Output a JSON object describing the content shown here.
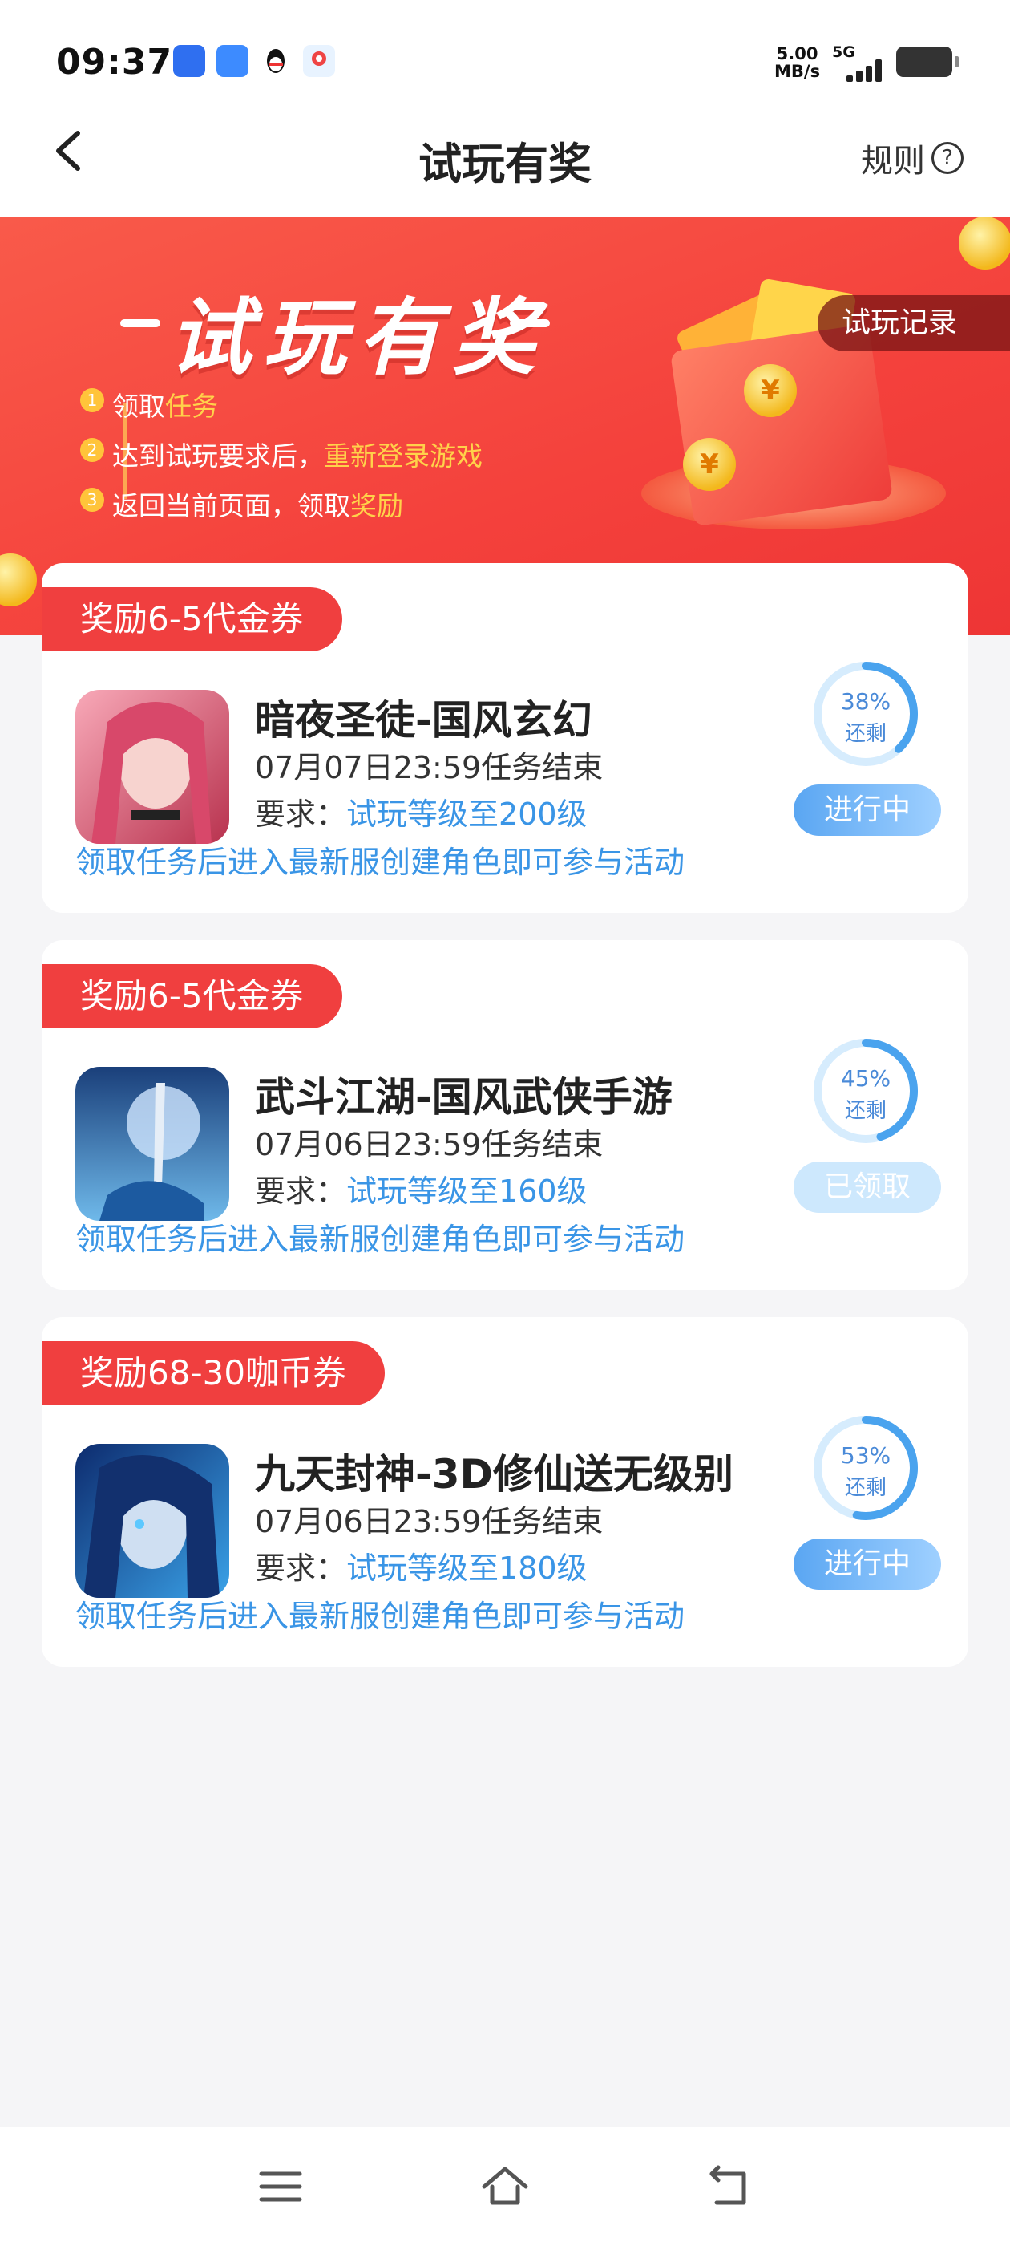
{
  "status_bar": {
    "time": "09:37",
    "net_speed_value": "5.00",
    "net_speed_unit": "MB/s",
    "network": "5G",
    "icons": [
      "baidu-map-icon",
      "browser-icon",
      "qq-icon",
      "maps-pin-icon"
    ]
  },
  "nav": {
    "title": "试玩有奖",
    "rules_label": "规则"
  },
  "banner": {
    "title": "试玩有奖",
    "record_button": "试玩记录",
    "steps": [
      {
        "num": "1",
        "text": "领取",
        "highlight": "任务"
      },
      {
        "num": "2",
        "text": "达到试玩要求后，",
        "highlight": "重新登录游戏"
      },
      {
        "num": "3",
        "text": "返回当前页面，领取",
        "highlight": "奖励"
      }
    ]
  },
  "colors": {
    "accent_red": "#f03f3f",
    "link_blue": "#3a95e6",
    "progress_blue": "#4aa3ee"
  },
  "tasks": [
    {
      "reward": "奖励6-5代金券",
      "game_name": "暗夜圣徒-国风玄幻",
      "deadline": "07月07日23:59任务结束",
      "requirement_label": "要求：",
      "requirement_value": "试玩等级至200级",
      "hint": "领取任务后进入最新服创建角色即可参与活动",
      "progress_percent": 38,
      "progress_text": "38%",
      "remaining_label": "还剩",
      "status": "进行中",
      "status_type": "active"
    },
    {
      "reward": "奖励6-5代金券",
      "game_name": "武斗江湖-国风武侠手游",
      "deadline": "07月06日23:59任务结束",
      "requirement_label": "要求：",
      "requirement_value": "试玩等级至160级",
      "hint": "领取任务后进入最新服创建角色即可参与活动",
      "progress_percent": 45,
      "progress_text": "45%",
      "remaining_label": "还剩",
      "status": "已领取",
      "status_type": "claimed"
    },
    {
      "reward": "奖励68-30咖币券",
      "game_name": "九天封神-3D修仙送无级别",
      "deadline": "07月06日23:59任务结束",
      "requirement_label": "要求：",
      "requirement_value": "试玩等级至180级",
      "hint": "领取任务后进入最新服创建角色即可参与活动",
      "progress_percent": 53,
      "progress_text": "53%",
      "remaining_label": "还剩",
      "status": "进行中",
      "status_type": "active"
    }
  ]
}
